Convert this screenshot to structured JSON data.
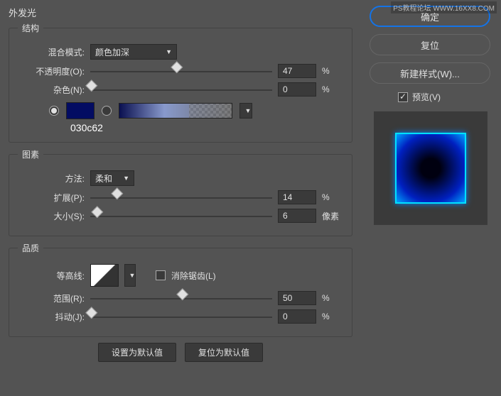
{
  "title": "外发光",
  "watermark": "PS教程论坛 WWW.16XX8.COM",
  "structure": {
    "legend": "结构",
    "blend_label": "混合模式:",
    "blend_value": "颜色加深",
    "opacity_label": "不透明度(O):",
    "opacity_value": "47",
    "opacity_unit": "%",
    "noise_label": "杂色(N):",
    "noise_value": "0",
    "noise_unit": "%",
    "color_code": "030c62"
  },
  "elements": {
    "legend": "图素",
    "technique_label": "方法:",
    "technique_value": "柔和",
    "spread_label": "扩展(P):",
    "spread_value": "14",
    "spread_unit": "%",
    "size_label": "大小(S):",
    "size_value": "6",
    "size_unit": "像素"
  },
  "quality": {
    "legend": "品质",
    "contour_label": "等高线:",
    "antialias_label": "消除锯齿(L)",
    "range_label": "范围(R):",
    "range_value": "50",
    "range_unit": "%",
    "jitter_label": "抖动(J):",
    "jitter_value": "0",
    "jitter_unit": "%"
  },
  "footer": {
    "set_default": "设置为默认值",
    "reset_default": "复位为默认值"
  },
  "sidebar": {
    "ok": "确定",
    "cancel": "复位",
    "new_style": "新建样式(W)...",
    "preview_label": "预览(V)"
  }
}
